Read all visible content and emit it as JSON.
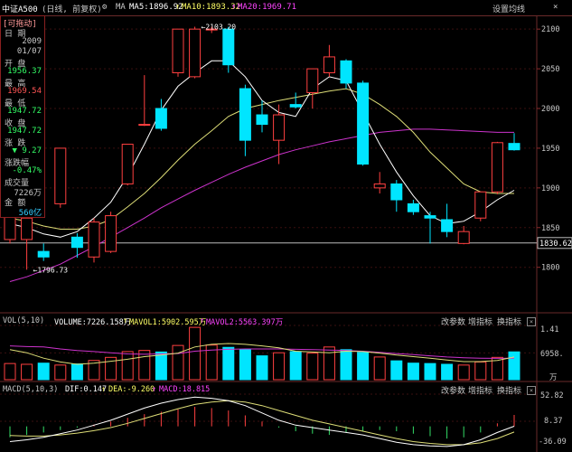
{
  "header": {
    "index_name": "中证A500",
    "mode": "(日线, 前复权)",
    "ma_label": "MA",
    "ma5": "MA5:1896.92",
    "ma10": "MA10:1893.32",
    "ma20": "MA20:1969.71",
    "settings_label": "设置均线"
  },
  "info_panel": {
    "drag_tag": "[可拖动]",
    "date_label": "日  期",
    "year": "2009",
    "date": "01/07",
    "open_label": "开  盘",
    "open": "1956.37",
    "high_label": "最  高",
    "high": "1969.54",
    "low_label": "最  低",
    "low": "1947.72",
    "close_label": "收  盘",
    "close": "1947.72",
    "change_label": "涨  跌",
    "change": "▼ 9.27",
    "pct_label": "涨跌幅",
    "pct": "-0.47%",
    "volume_label": "成交量",
    "volume": "7226万",
    "amount_label": "金  额",
    "amount": "560亿"
  },
  "volume_panel": {
    "title": "VOL(5,10)",
    "volume": "VOLUME:7226.158万",
    "mavol1": "MAVOL1:5902.595万",
    "mavol2": "MAVOL2:5563.397万",
    "btn_params": "改参数",
    "btn_add": "增指标",
    "btn_switch": "换指标",
    "tick_top": "1.41",
    "tick_mid": "6958.",
    "tick_bottom": "万"
  },
  "macd_panel": {
    "title": "MACD(5,10,3)",
    "dif": "DIF:0.147",
    "dea": "DEA:-9.260",
    "macd": "MACD:18.815",
    "btn_params": "改参数",
    "btn_add": "增指标",
    "btn_switch": "换指标",
    "tick_top": "52.82",
    "tick_mid": "8.37",
    "tick_bottom": "-36.09"
  },
  "price_axis": {
    "current_price": "1830.62"
  },
  "chart_data": [
    {
      "type": "candlestick",
      "ylim": [
        1745,
        2115
      ],
      "yticks": [
        1800,
        1850,
        1900,
        1950,
        2000,
        2050,
        2100
      ],
      "annotations": [
        {
          "text": "←2103.20",
          "value": 2103.2,
          "candle": 11
        },
        {
          "text": "←1796.73",
          "value": 1796.73,
          "candle": 1
        }
      ],
      "current_line": 1830.62,
      "candles": [
        {
          "o": 1835,
          "h": 1908,
          "c": 1895,
          "l": 1830
        },
        {
          "o": 1835,
          "h": 1860,
          "c": 1862,
          "l": 1797
        },
        {
          "o": 1820,
          "h": 1830,
          "c": 1813,
          "l": 1808
        },
        {
          "o": 1880,
          "h": 1900,
          "c": 1950,
          "l": 1875
        },
        {
          "o": 1838,
          "h": 1843,
          "c": 1825,
          "l": 1812
        },
        {
          "o": 1813,
          "h": 1862,
          "c": 1857,
          "l": 1806
        },
        {
          "o": 1820,
          "h": 1870,
          "c": 1865,
          "l": 1818
        },
        {
          "o": 1905,
          "h": 1955,
          "c": 1955,
          "l": 1903
        },
        {
          "o": 1980,
          "h": 2042,
          "c": 1980,
          "l": 1978
        },
        {
          "o": 2000,
          "h": 2012,
          "c": 1975,
          "l": 1972
        },
        {
          "o": 2045,
          "h": 2100,
          "c": 2100,
          "l": 2040
        },
        {
          "o": 2040,
          "h": 2103,
          "c": 2100,
          "l": 2038
        },
        {
          "o": 2100,
          "h": 2103,
          "c": 2100,
          "l": 2095
        },
        {
          "o": 2100,
          "h": 2103,
          "c": 2055,
          "l": 2045
        },
        {
          "o": 2025,
          "h": 2030,
          "c": 1960,
          "l": 1940
        },
        {
          "o": 1992,
          "h": 2010,
          "c": 1980,
          "l": 1970
        },
        {
          "o": 1960,
          "h": 2005,
          "c": 1992,
          "l": 1930
        },
        {
          "o": 2005,
          "h": 2020,
          "c": 2002,
          "l": 2000
        },
        {
          "o": 2020,
          "h": 2045,
          "c": 2050,
          "l": 2000
        },
        {
          "o": 2045,
          "h": 2080,
          "c": 2065,
          "l": 2040
        },
        {
          "o": 2060,
          "h": 2062,
          "c": 2032,
          "l": 2025
        },
        {
          "o": 2032,
          "h": 2035,
          "c": 1930,
          "l": 1928
        },
        {
          "o": 1900,
          "h": 1920,
          "c": 1905,
          "l": 1893
        },
        {
          "o": 1905,
          "h": 1910,
          "c": 1885,
          "l": 1870
        },
        {
          "o": 1880,
          "h": 1885,
          "c": 1870,
          "l": 1866
        },
        {
          "o": 1865,
          "h": 1870,
          "c": 1862,
          "l": 1830
        },
        {
          "o": 1860,
          "h": 1880,
          "c": 1845,
          "l": 1838
        },
        {
          "o": 1830,
          "h": 1852,
          "c": 1845,
          "l": 1829
        },
        {
          "o": 1862,
          "h": 1894,
          "c": 1895,
          "l": 1858
        },
        {
          "o": 1895,
          "h": 1958,
          "c": 1957,
          "l": 1892
        },
        {
          "o": 1956,
          "h": 1969,
          "c": 1948,
          "l": 1947
        }
      ],
      "ma5": [
        1855,
        1850,
        1842,
        1838,
        1845,
        1862,
        1882,
        1915,
        1955,
        1998,
        2028,
        2045,
        2060,
        2060,
        2040,
        2010,
        1995,
        1990,
        2025,
        2040,
        2035,
        1995,
        1955,
        1920,
        1890,
        1865,
        1855,
        1858,
        1870,
        1885,
        1897
      ],
      "ma10": [
        1862,
        1858,
        1852,
        1848,
        1848,
        1852,
        1860,
        1876,
        1893,
        1913,
        1935,
        1955,
        1972,
        1990,
        2000,
        2005,
        2010,
        2014,
        2018,
        2022,
        2025,
        2018,
        2005,
        1990,
        1970,
        1945,
        1925,
        1905,
        1895,
        1893,
        1893
      ],
      "ma20": [
        1782,
        1788,
        1796,
        1804,
        1815,
        1826,
        1838,
        1850,
        1862,
        1875,
        1886,
        1897,
        1907,
        1917,
        1926,
        1934,
        1942,
        1948,
        1953,
        1958,
        1962,
        1966,
        1970,
        1972,
        1974,
        1974,
        1973,
        1972,
        1971,
        1970,
        1970
      ]
    },
    {
      "type": "bar",
      "name": "VOL(5,10)",
      "ylim": [
        0,
        14100
      ],
      "values": [
        4200,
        4000,
        4300,
        3800,
        4100,
        5000,
        5800,
        7300,
        7600,
        7200,
        8900,
        13600,
        9000,
        8400,
        7800,
        6200,
        7000,
        7300,
        6900,
        8500,
        7800,
        7100,
        5900,
        4900,
        4300,
        4200,
        4000,
        3800,
        4600,
        5800,
        7226
      ],
      "mavol1": [
        7800,
        7000,
        5600,
        4600,
        4000,
        4300,
        4800,
        5300,
        6000,
        6400,
        6900,
        8500,
        9200,
        9400,
        9200,
        8800,
        8300,
        7400,
        7200,
        7000,
        7400,
        7300,
        6900,
        6400,
        6000,
        5600,
        5100,
        4700,
        4700,
        5000,
        5903
      ],
      "mavol2": [
        8800,
        8600,
        8500,
        8000,
        7600,
        7300,
        7000,
        6700,
        6600,
        6700,
        6800,
        7400,
        7700,
        7900,
        8000,
        8000,
        8000,
        7900,
        7800,
        7700,
        7600,
        7400,
        7100,
        6800,
        6500,
        6200,
        5900,
        5700,
        5600,
        5550,
        5563
      ]
    },
    {
      "type": "bar",
      "name": "MACD(5,10,3)",
      "ylim": [
        -36.09,
        52.82
      ],
      "macd": [
        -18,
        -14,
        -10,
        -6,
        -2,
        3,
        8,
        14,
        20,
        24,
        28,
        32,
        30,
        26,
        18,
        8,
        -2,
        -8,
        -12,
        -14,
        -10,
        -8,
        -6,
        -8,
        -12,
        -16,
        -20,
        -18,
        -10,
        5,
        18.8
      ],
      "dif": [
        -25,
        -22,
        -18,
        -12,
        -6,
        2,
        10,
        20,
        30,
        38,
        44,
        48,
        46,
        42,
        34,
        22,
        10,
        2,
        -2,
        -6,
        -10,
        -14,
        -20,
        -26,
        -30,
        -32,
        -33,
        -30,
        -22,
        -10,
        0.147
      ],
      "dea": [
        -15,
        -16,
        -16,
        -14,
        -11,
        -7,
        -2,
        5,
        13,
        21,
        29,
        36,
        40,
        42,
        40,
        34,
        26,
        18,
        10,
        4,
        -2,
        -8,
        -14,
        -20,
        -25,
        -28,
        -30,
        -30,
        -27,
        -20,
        -9.26
      ]
    }
  ]
}
